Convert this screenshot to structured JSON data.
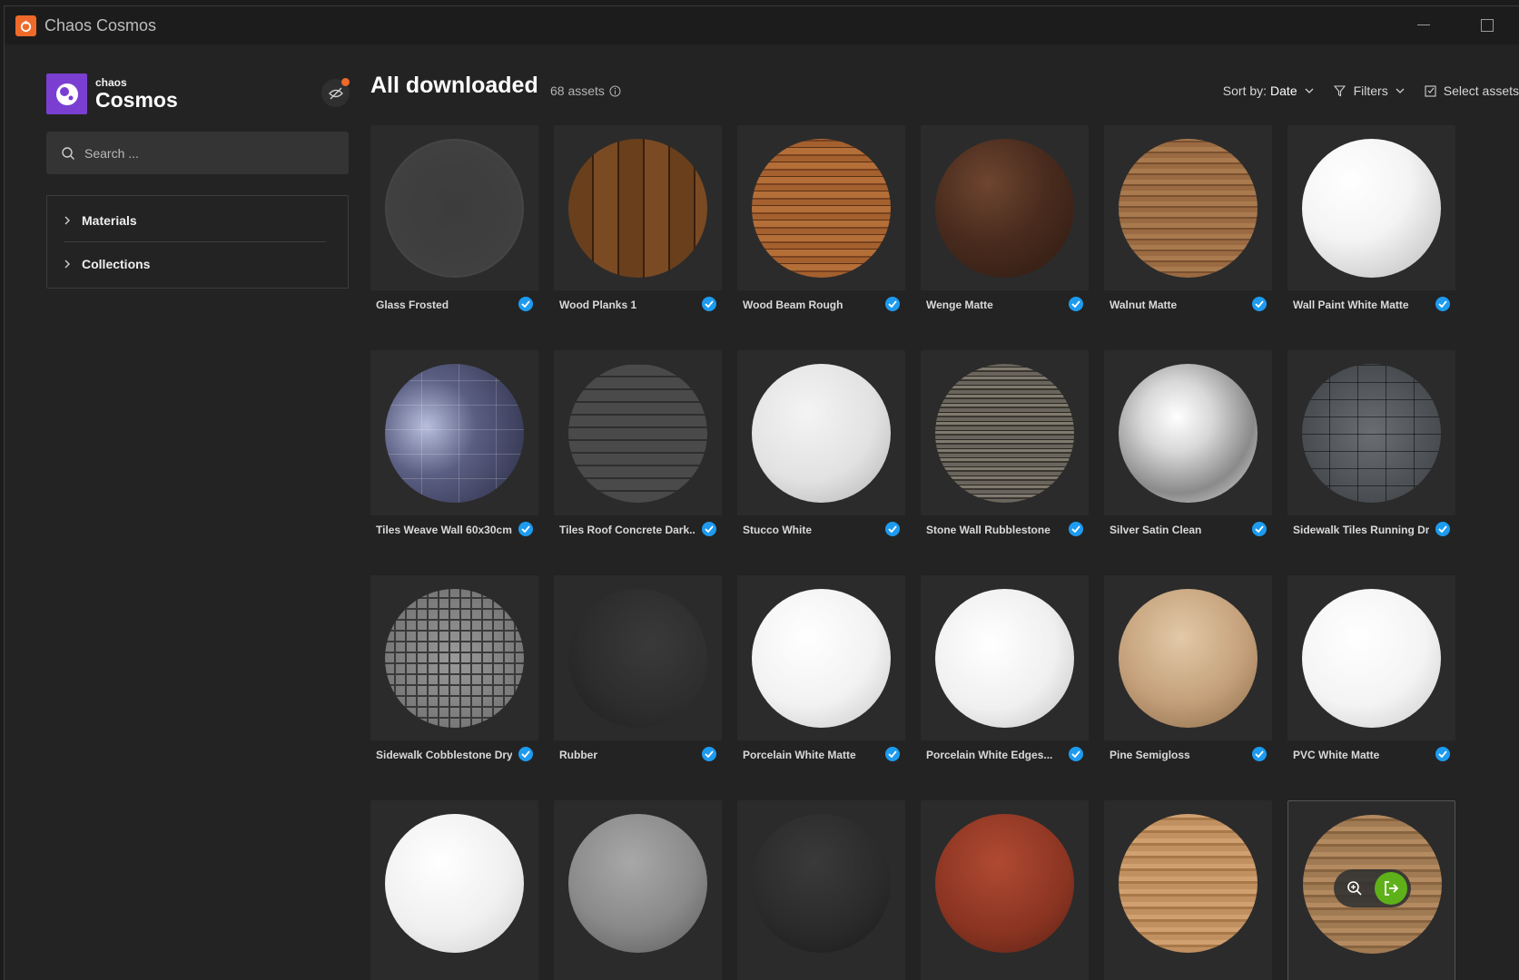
{
  "window": {
    "title": "Chaos Cosmos"
  },
  "sidebar": {
    "logo_small": "chaos",
    "logo_big": "Cosmos",
    "search_placeholder": "Search ...",
    "nav": [
      {
        "label": "Materials"
      },
      {
        "label": "Collections"
      }
    ]
  },
  "header": {
    "title": "All downloaded",
    "count": "68 assets",
    "sort_prefix": "Sort by:",
    "sort_value": "Date",
    "filters": "Filters",
    "select_assets": "Select assets"
  },
  "colors": {
    "accent": "#ef6a2a",
    "brand": "#7a3fd1",
    "check": "#1d9bf0",
    "action": "#5fb11a"
  },
  "assets": [
    {
      "name": "Glass Frosted",
      "downloaded": true
    },
    {
      "name": "Wood Planks 1",
      "downloaded": true
    },
    {
      "name": "Wood Beam Rough",
      "downloaded": true
    },
    {
      "name": "Wenge Matte",
      "downloaded": true
    },
    {
      "name": "Walnut Matte",
      "downloaded": true
    },
    {
      "name": "Wall Paint White Matte",
      "downloaded": true
    },
    {
      "name": "Tiles Weave Wall 60x30cm",
      "downloaded": true
    },
    {
      "name": "Tiles Roof Concrete Dark...",
      "downloaded": true
    },
    {
      "name": "Stucco White",
      "downloaded": true
    },
    {
      "name": "Stone Wall Rubblestone",
      "downloaded": true
    },
    {
      "name": "Silver Satin Clean",
      "downloaded": true
    },
    {
      "name": "Sidewalk Tiles Running Dry",
      "downloaded": true
    },
    {
      "name": "Sidewalk Cobblestone Dry",
      "downloaded": true
    },
    {
      "name": "Rubber",
      "downloaded": true
    },
    {
      "name": "Porcelain White Matte",
      "downloaded": true
    },
    {
      "name": "Porcelain White Edges...",
      "downloaded": true
    },
    {
      "name": "Pine Semigloss",
      "downloaded": true
    },
    {
      "name": "PVC White Matte",
      "downloaded": true
    },
    {
      "name": "",
      "downloaded": false
    },
    {
      "name": "",
      "downloaded": false
    },
    {
      "name": "",
      "downloaded": false
    },
    {
      "name": "",
      "downloaded": false
    },
    {
      "name": "",
      "downloaded": false
    },
    {
      "name": "",
      "downloaded": false
    }
  ]
}
